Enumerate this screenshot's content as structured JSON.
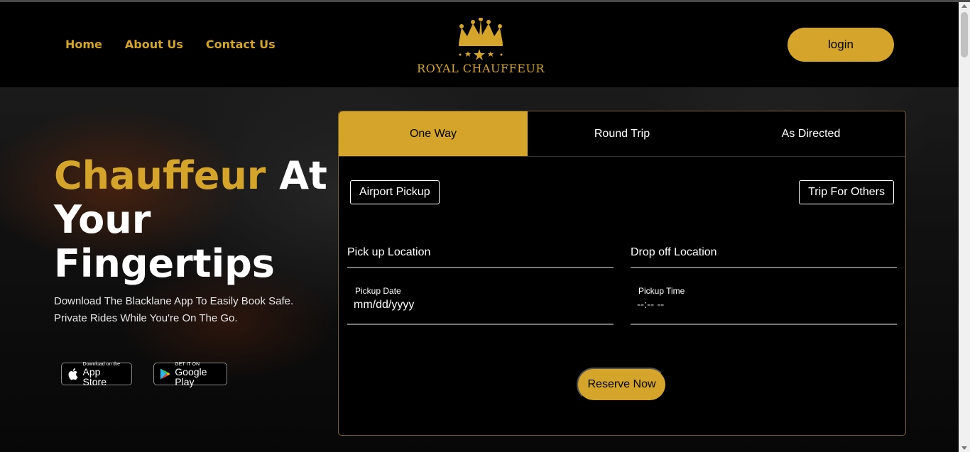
{
  "nav": {
    "items": [
      "Home",
      "About Us",
      "Contact Us"
    ]
  },
  "logo": {
    "text": "ROYAL CHAUFFEUR",
    "icon": "crown-icon"
  },
  "header": {
    "login_label": "login"
  },
  "hero": {
    "headline_gold": "Chauffeur",
    "headline_white": "At Your Fingertips",
    "subtext": "Download The Blacklane App To Easily Book Safe. Private Rides While You're On The Go."
  },
  "stores": {
    "appstore_small": "Download on the",
    "appstore_big": "App Store",
    "playstore_small": "GET IT ON",
    "playstore_big": "Google Play"
  },
  "booking": {
    "tabs": [
      "One Way",
      "Round Trip",
      "As Directed"
    ],
    "active_tab": "One Way",
    "airport_pickup": "Airport Pickup",
    "trip_for_others": "Trip For Others",
    "pickup_location_label": "Pick up Location",
    "dropoff_location_label": "Drop off Location",
    "pickup_date_label": "Pickup Date",
    "pickup_date_value": "mm/dd/yyyy",
    "pickup_time_label": "Pickup Time",
    "pickup_time_value": "--:-- --",
    "reserve_label": "Reserve Now"
  },
  "colors": {
    "accent": "#d4a52a",
    "background": "#000000"
  }
}
